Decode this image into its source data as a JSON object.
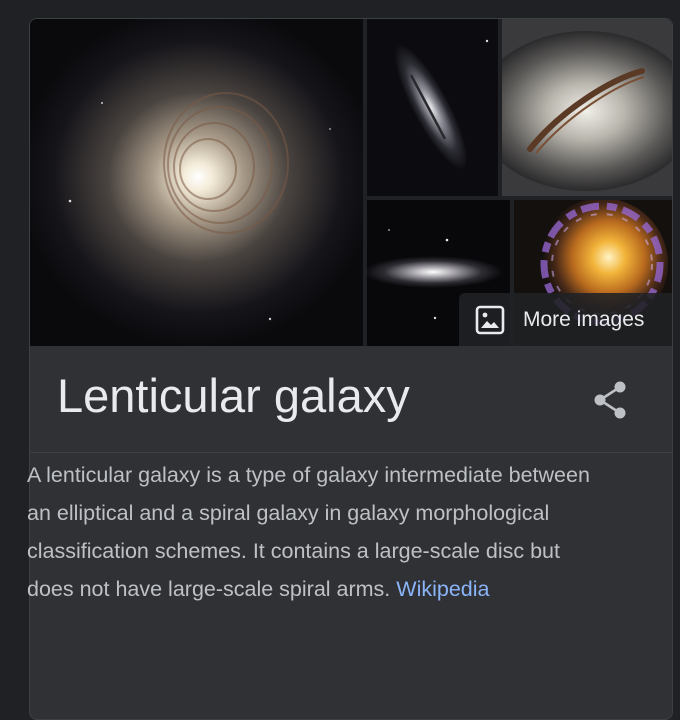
{
  "knowledge_panel": {
    "title": "Lenticular galaxy",
    "more_images_label": "More images",
    "description": "A lenticular galaxy is a type of galaxy intermediate between an elliptical and a spiral galaxy in galaxy morphological classification schemes. It contains a large-scale disc but does not have large-scale spiral arms.",
    "source_link": "Wikipedia",
    "icons": {
      "more_images": "image-icon",
      "share": "share-icon"
    }
  },
  "colors": {
    "background": "#202124",
    "panel": "#303134",
    "title_text": "#e8eaed",
    "body_text": "#bdc1c6",
    "link": "#8ab4f8"
  }
}
